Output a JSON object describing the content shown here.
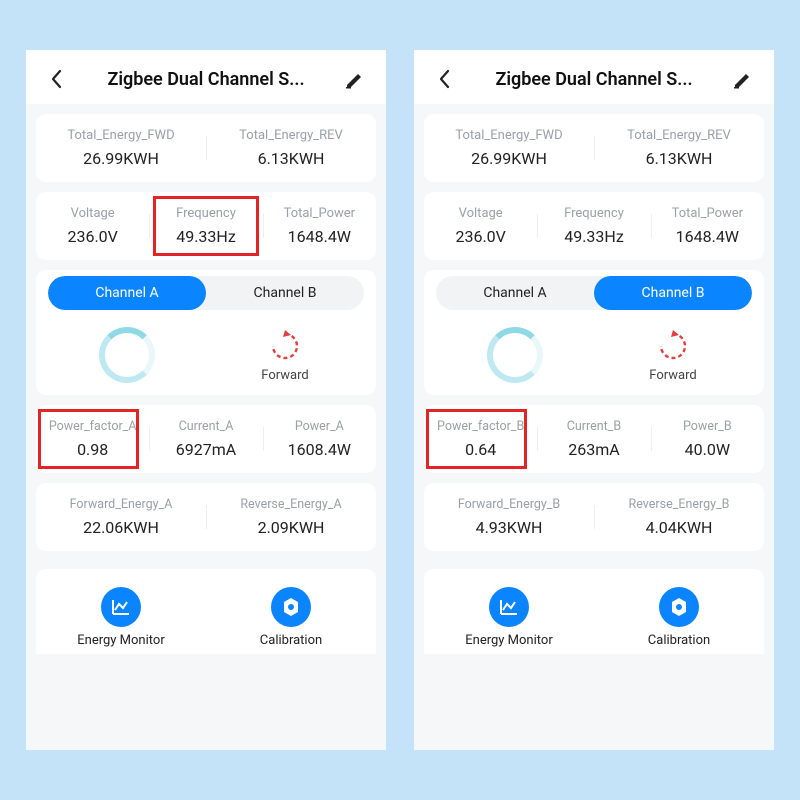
{
  "left": {
    "header": {
      "title": "Zigbee Dual Channel S..."
    },
    "energy": {
      "fwd_label": "Total_Energy_FWD",
      "fwd_value": "26.99KWH",
      "rev_label": "Total_Energy_REV",
      "rev_value": "6.13KWH"
    },
    "main": {
      "voltage_label": "Voltage",
      "voltage_value": "236.0V",
      "frequency_label": "Frequency",
      "frequency_value": "49.33Hz",
      "power_label": "Total_Power",
      "power_value": "1648.4W"
    },
    "tabs": {
      "a": "Channel A",
      "b": "Channel B",
      "active": "a"
    },
    "forward_label": "Forward",
    "chan": {
      "pf_label": "Power_factor_A",
      "pf_value": "0.98",
      "current_label": "Current_A",
      "current_value": "6927mA",
      "power_label": "Power_A",
      "power_value": "1608.4W",
      "fwd_label": "Forward_Energy_A",
      "fwd_value": "22.06KWH",
      "rev_label": "Reverse_Energy_A",
      "rev_value": "2.09KWH"
    },
    "bottom": {
      "monitor": "Energy Monitor",
      "calib": "Calibration"
    }
  },
  "right": {
    "header": {
      "title": "Zigbee Dual Channel S..."
    },
    "energy": {
      "fwd_label": "Total_Energy_FWD",
      "fwd_value": "26.99KWH",
      "rev_label": "Total_Energy_REV",
      "rev_value": "6.13KWH"
    },
    "main": {
      "voltage_label": "Voltage",
      "voltage_value": "236.0V",
      "frequency_label": "Frequency",
      "frequency_value": "49.33Hz",
      "power_label": "Total_Power",
      "power_value": "1648.4W"
    },
    "tabs": {
      "a": "Channel A",
      "b": "Channel B",
      "active": "b"
    },
    "forward_label": "Forward",
    "chan": {
      "pf_label": "Power_factor_B",
      "pf_value": "0.64",
      "current_label": "Current_B",
      "current_value": "263mA",
      "power_label": "Power_B",
      "power_value": "40.0W",
      "fwd_label": "Forward_Energy_B",
      "fwd_value": "4.93KWH",
      "rev_label": "Reverse_Energy_B",
      "rev_value": "4.04KWH"
    },
    "bottom": {
      "monitor": "Energy Monitor",
      "calib": "Calibration"
    }
  }
}
